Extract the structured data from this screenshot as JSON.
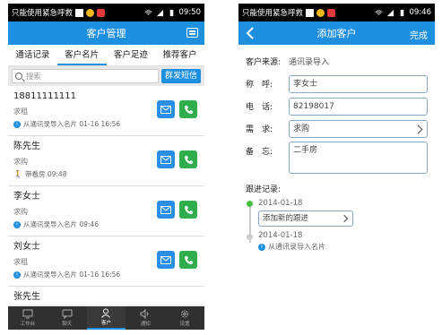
{
  "left": {
    "status": {
      "carrier": "只能使用紧急呼救",
      "time": "09:50"
    },
    "title": "客户管理",
    "tabs": [
      {
        "label": "通话记录"
      },
      {
        "label": "客户名片"
      },
      {
        "label": "客户足迹"
      },
      {
        "label": "推荐客户"
      }
    ],
    "search": {
      "placeholder": "搜索",
      "group_sms": "群发短信"
    },
    "customers": [
      {
        "name": "18811111111",
        "req": "求租",
        "note": "从通讯录导入名片 01-16 16:56",
        "note_icon": "info-icon"
      },
      {
        "name": "陈先生",
        "req": "求购",
        "note": "带看房 09:48",
        "note_icon": "walk-icon"
      },
      {
        "name": "李女士",
        "req": "求购",
        "note": "从通讯录导入名片 09:46",
        "note_icon": "info-icon"
      },
      {
        "name": "刘女士",
        "req": "求租",
        "note": "从通讯录导入名片 01-16 16:56",
        "note_icon": "info-icon"
      },
      {
        "name": "张先生"
      }
    ],
    "nav": [
      {
        "label": "工作台",
        "icon": "monitor-icon"
      },
      {
        "label": "聊天",
        "icon": "chat-icon"
      },
      {
        "label": "客户",
        "icon": "person-icon"
      },
      {
        "label": "通知",
        "icon": "speaker-icon"
      },
      {
        "label": "设置",
        "icon": "gear-icon"
      }
    ],
    "active_nav": 2
  },
  "right": {
    "status": {
      "carrier": "只能使用紧急呼救",
      "time": "09:46"
    },
    "title": "添加客户",
    "done": "完成",
    "form": {
      "source_label": "客户来源:",
      "source_value": "通讯录导入",
      "name_label": "称　呼:",
      "name_value": "李女士",
      "phone_label": "电　话:",
      "phone_value": "82198017",
      "need_label": "需　求:",
      "need_value": "求购",
      "memo_label": "备　忘:",
      "memo_value": "二手房"
    },
    "followup": {
      "label": "跟进记录:",
      "date1": "2014-01-18",
      "add_button": "添加新的跟进",
      "date2": "2014-01-18",
      "note": "从通讯录导入名片"
    }
  },
  "colors": {
    "accent": "#1f8fe0",
    "call_green": "#2fae4b",
    "mail_blue": "#2b8ee8",
    "nav_bg": "#303030"
  }
}
